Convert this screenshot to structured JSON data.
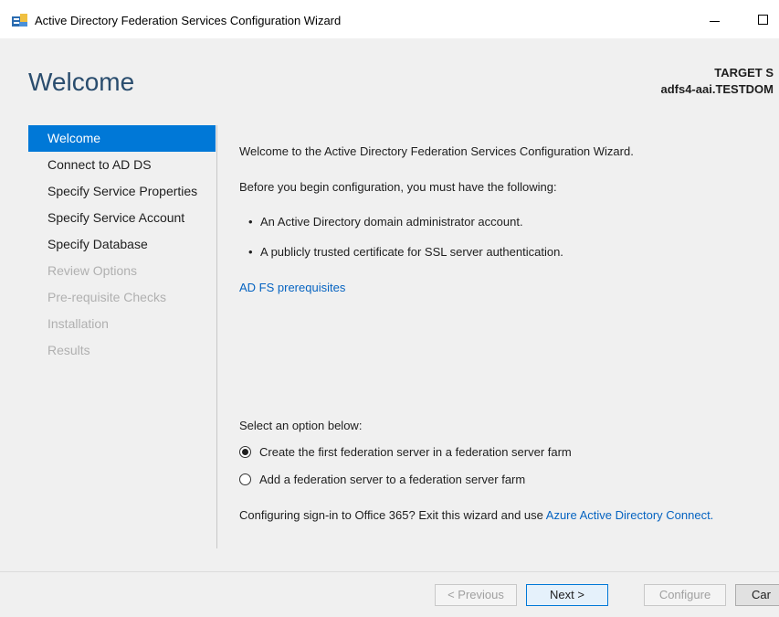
{
  "window": {
    "title": "Active Directory Federation Services Configuration Wizard",
    "icon": "adfs-wizard-icon"
  },
  "header": {
    "page_title": "Welcome",
    "target_label": "TARGET S",
    "target_server": "adfs4-aai.TESTDOM"
  },
  "nav": {
    "items": [
      {
        "label": "Welcome",
        "state": "active"
      },
      {
        "label": "Connect to AD DS",
        "state": "enabled"
      },
      {
        "label": "Specify Service Properties",
        "state": "enabled"
      },
      {
        "label": "Specify Service Account",
        "state": "enabled"
      },
      {
        "label": "Specify Database",
        "state": "enabled"
      },
      {
        "label": "Review Options",
        "state": "disabled"
      },
      {
        "label": "Pre-requisite Checks",
        "state": "disabled"
      },
      {
        "label": "Installation",
        "state": "disabled"
      },
      {
        "label": "Results",
        "state": "disabled"
      }
    ]
  },
  "content": {
    "intro": "Welcome to the Active Directory Federation Services Configuration Wizard.",
    "before": "Before you begin configuration, you must have the following:",
    "bullets": [
      "An Active Directory domain administrator account.",
      "A publicly trusted certificate for SSL server authentication."
    ],
    "prereq_link": "AD FS prerequisites",
    "select_prompt": "Select an option below:",
    "options": [
      {
        "label": "Create the first federation server in a federation server farm",
        "checked": true
      },
      {
        "label": "Add a federation server to a federation server farm",
        "checked": false
      }
    ],
    "office_text": "Configuring sign-in to Office 365? Exit this wizard and use ",
    "office_link": "Azure Active Directory Connect."
  },
  "footer": {
    "previous": "< Previous",
    "next": "Next >",
    "configure": "Configure",
    "cancel": "Car"
  },
  "colors": {
    "accent": "#0078d7",
    "title": "#2a4d6e",
    "link": "#0563c1"
  }
}
